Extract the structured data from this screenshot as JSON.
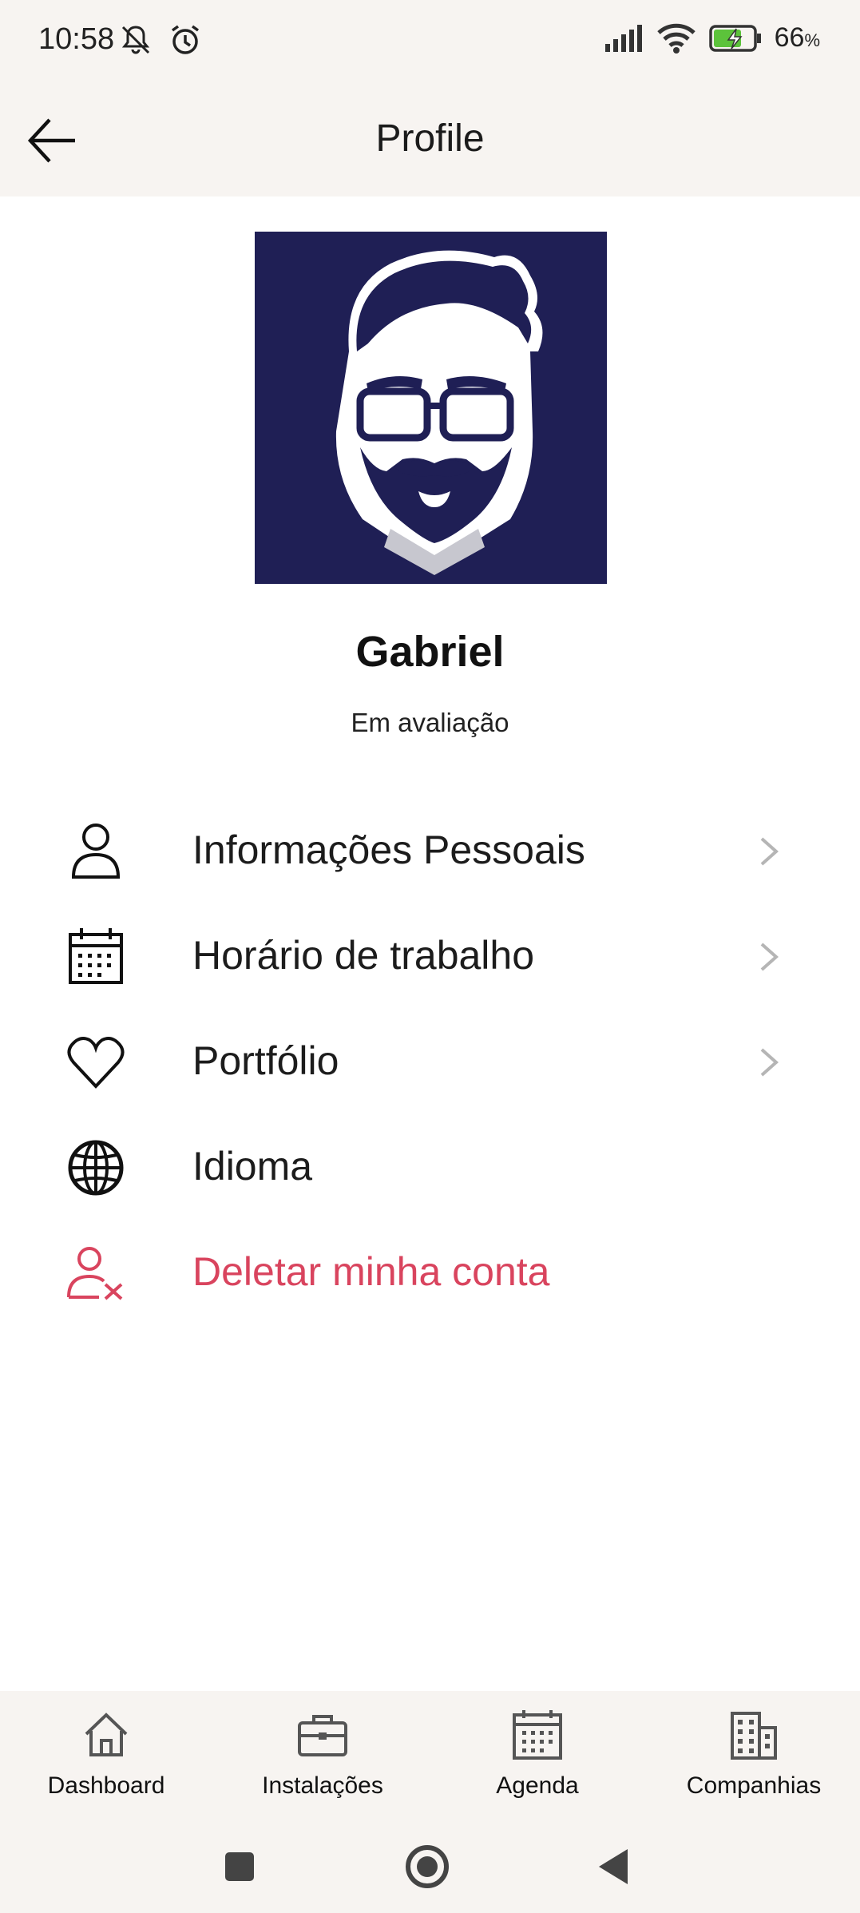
{
  "status_bar": {
    "time": "10:58",
    "battery_percent": "66",
    "battery_unit": "%",
    "icons": [
      "mute-icon",
      "alarm-icon",
      "signal-icon",
      "wifi-icon",
      "battery-charging-icon"
    ]
  },
  "header": {
    "title": "Profile",
    "back_icon": "arrow-left-icon"
  },
  "profile": {
    "name": "Gabriel",
    "status": "Em avaliação",
    "avatar_icon": "bearded-man-glasses-avatar"
  },
  "menu": {
    "items": [
      {
        "label": "Informações Pessoais",
        "icon": "person-icon",
        "chevron": true
      },
      {
        "label": "Horário de trabalho",
        "icon": "calendar-icon",
        "chevron": true
      },
      {
        "label": "Portfólio",
        "icon": "heart-icon",
        "chevron": true
      },
      {
        "label": "Idioma",
        "icon": "globe-icon",
        "chevron": false
      },
      {
        "label": "Deletar minha conta",
        "icon": "person-remove-icon",
        "chevron": false
      }
    ]
  },
  "bottom_nav": {
    "items": [
      {
        "label": "Dashboard",
        "icon": "home-icon"
      },
      {
        "label": "Instalações",
        "icon": "briefcase-icon"
      },
      {
        "label": "Agenda",
        "icon": "calendar-icon"
      },
      {
        "label": "Companhias",
        "icon": "building-icon"
      }
    ]
  },
  "colors": {
    "bar_background": "#f7f4f1",
    "avatar_background": "#1f1f55",
    "danger": "#d9445e",
    "chevron": "#b5b5b5"
  }
}
